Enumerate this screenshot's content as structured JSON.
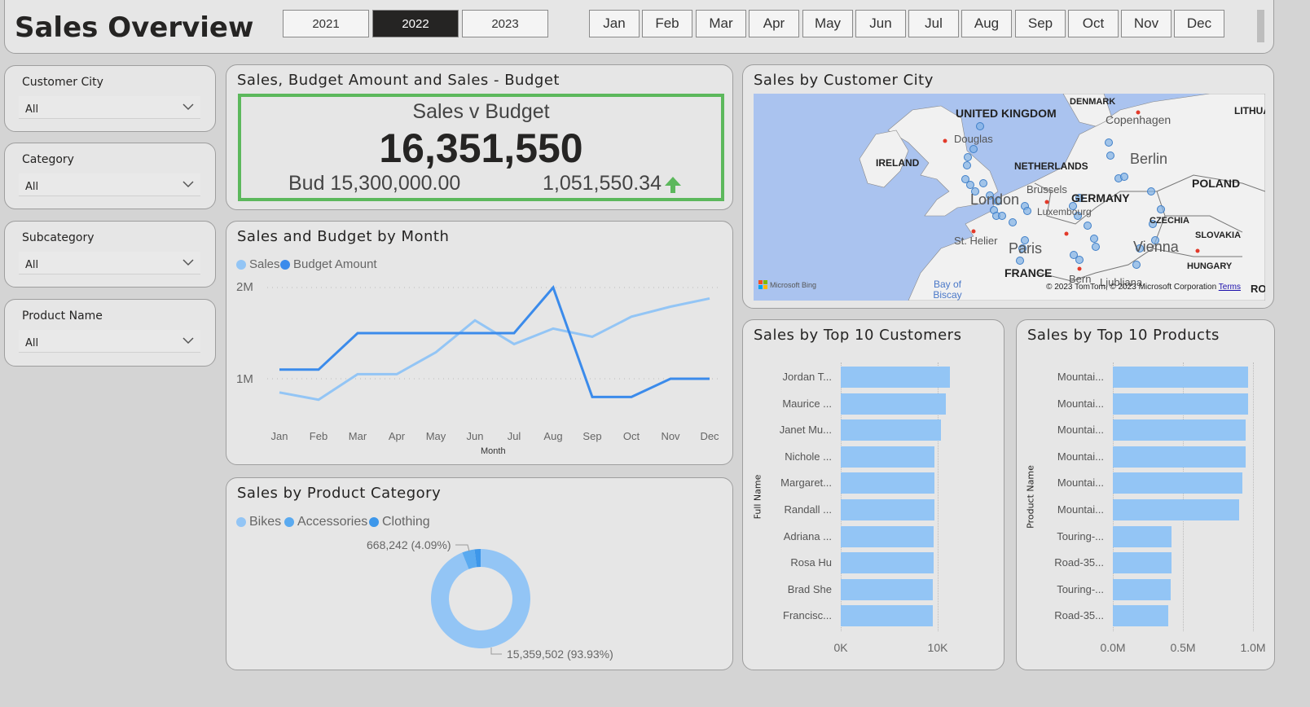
{
  "header": {
    "title": "Sales Overview",
    "years": [
      {
        "label": "2021",
        "selected": false
      },
      {
        "label": "2022",
        "selected": true
      },
      {
        "label": "2023",
        "selected": false
      }
    ],
    "months": [
      "Jan",
      "Feb",
      "Mar",
      "Apr",
      "May",
      "Jun",
      "Jul",
      "Aug",
      "Sep",
      "Oct",
      "Nov",
      "Dec"
    ]
  },
  "slicers": [
    {
      "label": "Customer City",
      "value": "All"
    },
    {
      "label": "Category",
      "value": "All"
    },
    {
      "label": "Subcategory",
      "value": "All"
    },
    {
      "label": "Product Name",
      "value": "All"
    }
  ],
  "kpi": {
    "title": "Sales, Budget Amount and Sales - Budget",
    "heading": "Sales v Budget",
    "value": "16,351,550",
    "budget": "Bud 15,300,000.00",
    "variance": "1,051,550.34",
    "trend_icon": "arrow-up-icon",
    "accent": "#5cb85c"
  },
  "colors": {
    "sales": "#93c5f5",
    "budget": "#3b8beb",
    "accessories": "#5aaaf0",
    "clothing": "#3d97ea",
    "selected": "#252423"
  },
  "chart_data": [
    {
      "type": "line",
      "title": "Sales and Budget by Month",
      "xlabel": "Month",
      "ylabel": "",
      "categories": [
        "Jan",
        "Feb",
        "Mar",
        "Apr",
        "May",
        "Jun",
        "Jul",
        "Aug",
        "Sep",
        "Oct",
        "Nov",
        "Dec"
      ],
      "yticks": [
        "1M",
        "2M"
      ],
      "ytick_values": [
        1000000,
        2000000
      ],
      "grid": true,
      "legend": "top-left",
      "series": [
        {
          "name": "Sales",
          "values": [
            850000,
            770000,
            1050000,
            1050000,
            1290000,
            1640000,
            1380000,
            1550000,
            1460000,
            1680000,
            1790000,
            1880000
          ]
        },
        {
          "name": "Budget Amount",
          "values": [
            1100000,
            1100000,
            1500000,
            1500000,
            1500000,
            1500000,
            1500000,
            2000000,
            800000,
            800000,
            1000000,
            1000000
          ]
        }
      ]
    },
    {
      "type": "pie",
      "title": "Sales by Product Category",
      "legend": "top-left",
      "categories": [
        "Bikes",
        "Accessories",
        "Clothing"
      ],
      "values": [
        15359502,
        668242,
        323806
      ],
      "labels": {
        "Bikes": "15,359,502 (93.93%)",
        "Accessories": "668,242 (4.09%)"
      }
    },
    {
      "type": "bar",
      "title": "Sales by Top 10 Customers",
      "ylabel": "Full Name",
      "xticks": [
        "0K",
        "10K"
      ],
      "xtick_values": [
        0,
        10000
      ],
      "categories": [
        "Jordan T...",
        "Maurice ...",
        "Janet Mu...",
        "Nichole ...",
        "Margaret...",
        "Randall ...",
        "Adriana ...",
        "Rosa Hu",
        "Brad She",
        "Francisc..."
      ],
      "values": [
        11300,
        10800,
        10300,
        9700,
        9700,
        9700,
        9600,
        9600,
        9500,
        9500
      ]
    },
    {
      "type": "bar",
      "title": "Sales by Top 10 Products",
      "ylabel": "Product Name",
      "xticks": [
        "0.0M",
        "0.5M",
        "1.0M"
      ],
      "xtick_values": [
        0,
        500000,
        1000000
      ],
      "categories": [
        "Mountai...",
        "Mountai...",
        "Mountai...",
        "Mountai...",
        "Mountai...",
        "Mountai...",
        "Touring-...",
        "Road-35...",
        "Touring-...",
        "Road-35..."
      ],
      "values": [
        965000,
        965000,
        950000,
        950000,
        925000,
        900000,
        420000,
        420000,
        410000,
        395000
      ]
    }
  ],
  "map": {
    "title": "Sales by Customer City",
    "labels": [
      "UNITED KINGDOM",
      "IRELAND",
      "NETHERLANDS",
      "GERMANY",
      "DENMARK",
      "POLAND",
      "CZECHIA",
      "SLOVAKIA",
      "HUNGARY",
      "FRANCE",
      "Copenhagen",
      "Berlin",
      "Brussels",
      "London",
      "Luxembourg",
      "Paris",
      "Vienna",
      "Douglas",
      "St. Helier",
      "Bern",
      "Ljubljana",
      "Bay of Biscay",
      "LITHUA",
      "RO"
    ],
    "brand": "Microsoft Bing",
    "copyright": "© 2023 TomTom, © 2023 Microsoft Corporation",
    "terms": "Terms"
  }
}
